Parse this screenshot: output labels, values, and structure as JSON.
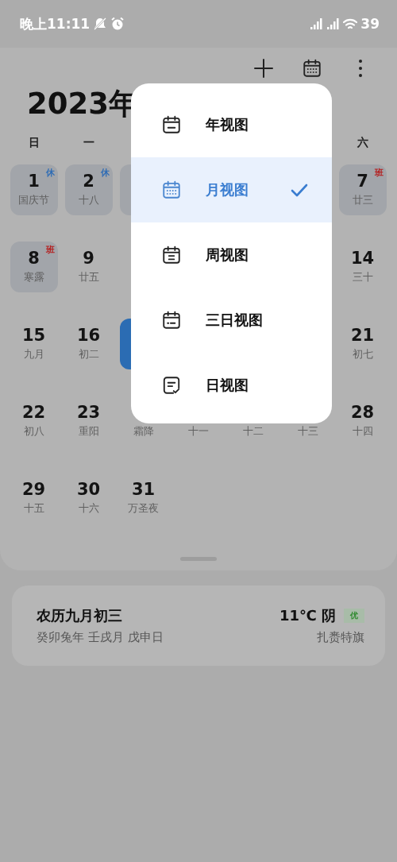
{
  "status_bar": {
    "time": "晚上11:11",
    "battery": "39"
  },
  "toolbar": {
    "title": "2023年"
  },
  "weekdays": [
    {
      "kind": "label",
      "label": "日"
    },
    {
      "kind": "label",
      "label": "一"
    },
    {
      "kind": "covered"
    },
    {
      "kind": "covered"
    },
    {
      "kind": "covered"
    },
    {
      "kind": "covered"
    },
    {
      "kind": "label",
      "label": "六"
    }
  ],
  "weeks": [
    [
      {
        "kind": "day",
        "day": "1",
        "lunar": "国庆节",
        "badge": {
          "text": "休",
          "color": "#2e6cb5"
        },
        "shaded": true,
        "selected": false
      },
      {
        "kind": "day",
        "day": "2",
        "lunar": "十八",
        "badge": {
          "text": "休",
          "color": "#2e6cb5"
        },
        "shaded": true,
        "selected": false
      },
      {
        "kind": "covered",
        "shaded": true
      },
      {
        "kind": "covered"
      },
      {
        "kind": "covered"
      },
      {
        "kind": "covered"
      },
      {
        "kind": "day",
        "day": "7",
        "lunar": "廿三",
        "badge": {
          "text": "班",
          "color": "#b42020"
        },
        "shaded": true,
        "selected": false
      }
    ],
    [
      {
        "kind": "day",
        "day": "8",
        "lunar": "寒露",
        "badge": {
          "text": "班",
          "color": "#b42020"
        },
        "shaded": true,
        "selected": false
      },
      {
        "kind": "day",
        "day": "9",
        "lunar": "廿五",
        "shaded": false,
        "selected": false
      },
      {
        "kind": "covered"
      },
      {
        "kind": "covered"
      },
      {
        "kind": "covered"
      },
      {
        "kind": "covered"
      },
      {
        "kind": "day",
        "day": "14",
        "lunar": "三十",
        "shaded": false,
        "selected": false
      }
    ],
    [
      {
        "kind": "day",
        "day": "15",
        "lunar": "九月",
        "shaded": false,
        "selected": false
      },
      {
        "kind": "day",
        "day": "16",
        "lunar": "初二",
        "shaded": false,
        "selected": false
      },
      {
        "kind": "covered",
        "selected": true
      },
      {
        "kind": "covered"
      },
      {
        "kind": "covered"
      },
      {
        "kind": "covered"
      },
      {
        "kind": "day",
        "day": "21",
        "lunar": "初七",
        "shaded": false,
        "selected": false
      }
    ],
    [
      {
        "kind": "day",
        "day": "22",
        "lunar": "初八",
        "shaded": false,
        "selected": false
      },
      {
        "kind": "day",
        "day": "23",
        "lunar": "重阳",
        "shaded": false,
        "selected": false
      },
      {
        "kind": "day",
        "lunar": "霜降",
        "shaded": false,
        "selected": false
      },
      {
        "kind": "day",
        "lunar": "十一",
        "shaded": false,
        "selected": false
      },
      {
        "kind": "day",
        "lunar": "十二",
        "shaded": false,
        "selected": false
      },
      {
        "kind": "day",
        "lunar": "十三",
        "shaded": false,
        "selected": false
      },
      {
        "kind": "day",
        "day": "28",
        "lunar": "十四",
        "shaded": false,
        "selected": false
      }
    ],
    [
      {
        "kind": "day",
        "day": "29",
        "lunar": "十五",
        "shaded": false,
        "selected": false
      },
      {
        "kind": "day",
        "day": "30",
        "lunar": "十六",
        "shaded": false,
        "selected": false
      },
      {
        "kind": "day",
        "day": "31",
        "lunar": "万圣夜",
        "shaded": false,
        "selected": false
      }
    ]
  ],
  "lunar_card": {
    "date": "农历九月初三",
    "ganzhi": "癸卯兔年 壬戌月 戊申日",
    "weather": "11℃ 阴",
    "air_quality": "优",
    "location": "扎赉特旗"
  },
  "menu": {
    "items": [
      {
        "kind": "year",
        "label": "年视图",
        "selected": false
      },
      {
        "kind": "month",
        "label": "月视图",
        "selected": true
      },
      {
        "kind": "week",
        "label": "周视图",
        "selected": false
      },
      {
        "kind": "three_day",
        "label": "三日视图",
        "selected": false
      },
      {
        "kind": "day",
        "label": "日视图",
        "selected": false
      }
    ]
  }
}
